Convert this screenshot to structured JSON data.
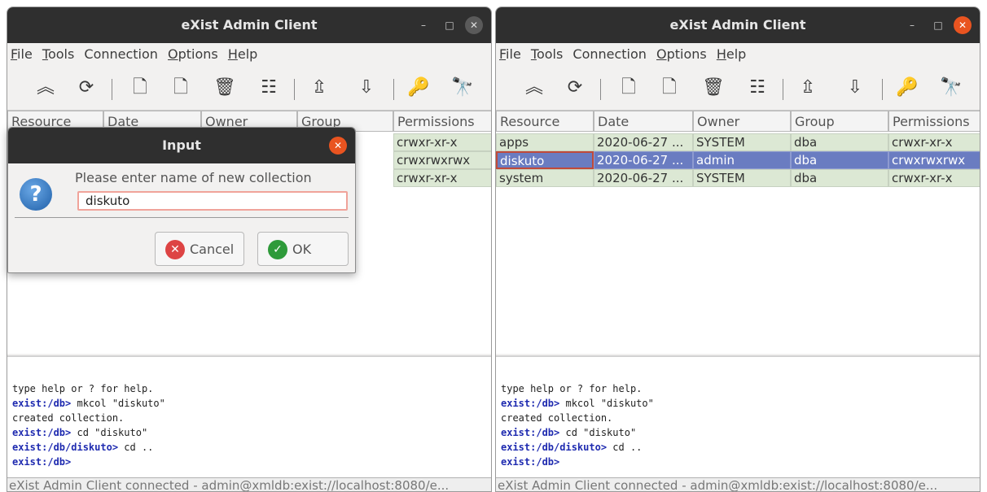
{
  "window_title": "eXist Admin Client",
  "window_controls": {
    "minimize": "–",
    "maximize": "□",
    "close": "✕"
  },
  "menu": {
    "items": [
      {
        "first": "F",
        "rest": "ile"
      },
      {
        "first": "T",
        "rest": "ools"
      },
      {
        "first": "",
        "rest": "Connection"
      },
      {
        "first": "O",
        "rest": "ptions"
      },
      {
        "first": "H",
        "rest": "elp"
      }
    ]
  },
  "toolbar": {
    "icons": [
      "go-up-icon",
      "refresh-icon",
      "new-collection-icon",
      "new-document-icon",
      "delete-icon",
      "properties-icon",
      "upload-icon",
      "download-icon",
      "keys-icon",
      "find-icon"
    ],
    "glyphs": [
      "︽",
      "⟳",
      "🗋",
      "🗋",
      "🗑",
      "☷",
      "⇫",
      "⇩",
      "🔑",
      "🔭"
    ]
  },
  "table": {
    "columns": [
      "Resource",
      "Date",
      "Owner",
      "Group",
      "Permissions"
    ],
    "left_rows": [
      {
        "resource": "",
        "date": "",
        "owner": "",
        "group": "",
        "permissions": "crwxr-xr-x"
      },
      {
        "resource": "",
        "date": "",
        "owner": "",
        "group": "",
        "permissions": "crwxrwxrwx"
      },
      {
        "resource": "",
        "date": "",
        "owner": "",
        "group": "",
        "permissions": "crwxr-xr-x"
      }
    ],
    "right_rows": [
      {
        "resource": "apps",
        "date": "2020-06-27 ...",
        "owner": "SYSTEM",
        "group": "dba",
        "permissions": "crwxr-xr-x",
        "selected": false
      },
      {
        "resource": "diskuto",
        "date": "2020-06-27 ...",
        "owner": "admin",
        "group": "dba",
        "permissions": "crwxrwxrwx",
        "selected": true
      },
      {
        "resource": "system",
        "date": "2020-06-27 ...",
        "owner": "SYSTEM",
        "group": "dba",
        "permissions": "crwxr-xr-x",
        "selected": false
      }
    ]
  },
  "console": {
    "lines": [
      {
        "prompt": "",
        "text": "type help or ? for help."
      },
      {
        "prompt": "exist:/db>",
        "text": " mkcol \"diskuto\""
      },
      {
        "prompt": "",
        "text": "created collection."
      },
      {
        "prompt": "exist:/db>",
        "text": " cd \"diskuto\""
      },
      {
        "prompt": "exist:/db/diskuto>",
        "text": " cd .."
      },
      {
        "prompt": "exist:/db>",
        "text": ""
      }
    ]
  },
  "status": "eXist Admin Client connected - admin@xmldb:exist://localhost:8080/e...",
  "dialog": {
    "title": "Input",
    "prompt": "Please enter name of new collection",
    "value": "diskuto",
    "cancel_label": "Cancel",
    "ok_label": "OK",
    "question_glyph": "?"
  },
  "colors": {
    "titlebar": "#2f2f2f",
    "close_active": "#e95420",
    "row_bg": "#dce8d4",
    "row_selected": "#6a7cc1",
    "prompt": "#1f2bb0"
  }
}
